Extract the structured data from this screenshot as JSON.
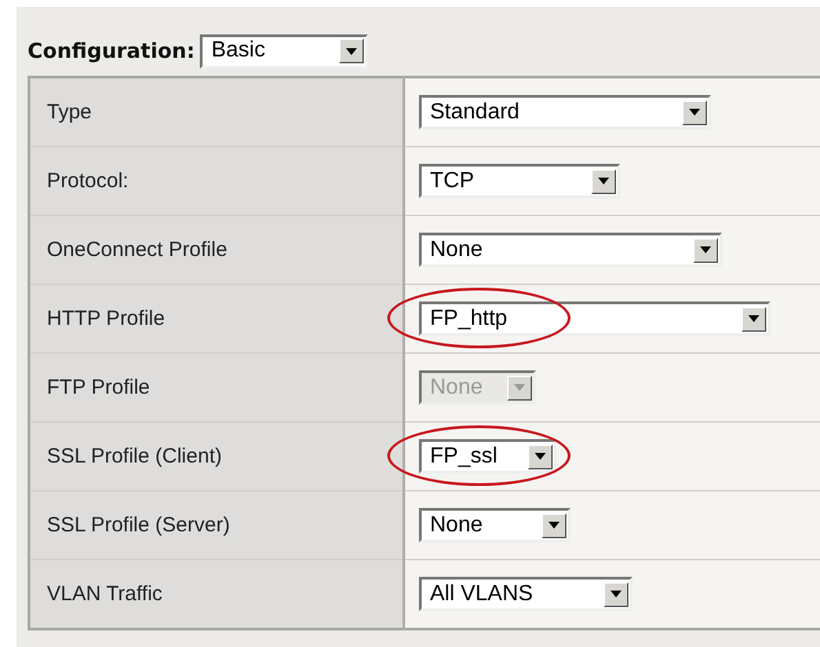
{
  "configuration": {
    "label": "Configuration:",
    "value": "Basic"
  },
  "rows": [
    {
      "label": "Type",
      "value": "Standard",
      "disabled": false,
      "highlighted": false
    },
    {
      "label": "Protocol:",
      "value": "TCP",
      "disabled": false,
      "highlighted": false
    },
    {
      "label": "OneConnect Profile",
      "value": "None",
      "disabled": false,
      "highlighted": false
    },
    {
      "label": "HTTP Profile",
      "value": "FP_http",
      "disabled": false,
      "highlighted": true
    },
    {
      "label": "FTP Profile",
      "value": "None",
      "disabled": true,
      "highlighted": false
    },
    {
      "label": "SSL Profile (Client)",
      "value": "FP_ssl",
      "disabled": false,
      "highlighted": true
    },
    {
      "label": "SSL Profile (Server)",
      "value": "None",
      "disabled": false,
      "highlighted": false
    },
    {
      "label": "VLAN Traffic",
      "value": "All VLANS",
      "disabled": false,
      "highlighted": false
    }
  ]
}
